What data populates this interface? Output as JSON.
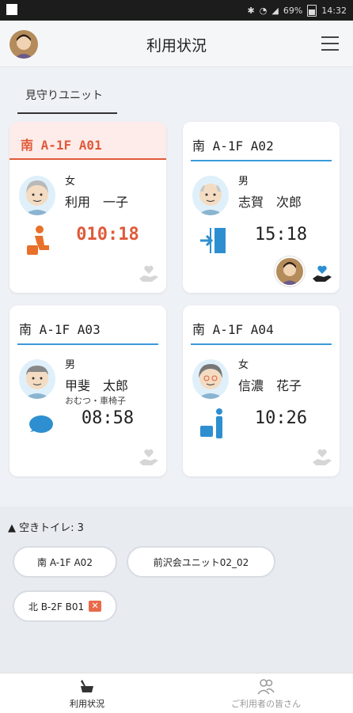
{
  "status_bar": {
    "battery": "69%",
    "time": "14:32"
  },
  "app": {
    "title": "利用状況"
  },
  "tab": {
    "label": "見守りユニット"
  },
  "units": [
    {
      "name": "南 A-1F A01",
      "gender": "女",
      "user_name": "利用　一子",
      "note": "",
      "time": "010:18",
      "state": "toilet-seated",
      "alert": true
    },
    {
      "name": "南 A-1F A02",
      "gender": "男",
      "user_name": "志賀　次郎",
      "note": "",
      "time": "15:18",
      "state": "exit",
      "alert": false
    },
    {
      "name": "南 A-1F A03",
      "gender": "男",
      "user_name": "甲斐　太郎",
      "note": "おむつ・車椅子",
      "time": "08:58",
      "state": "speech",
      "alert": false
    },
    {
      "name": "南 A-1F A04",
      "gender": "女",
      "user_name": "信濃　花子",
      "note": "",
      "time": "10:26",
      "state": "toilet-standing",
      "alert": false
    }
  ],
  "vacant": {
    "title": "▲ 空きトイレ: 3",
    "chips": [
      {
        "label": "南 A-1F A02"
      },
      {
        "label": "前沢会ユニット02_02"
      },
      {
        "label": "北 B-2F B01"
      }
    ]
  },
  "nav": {
    "usage": "利用状況",
    "users": "ご利用者の皆さん"
  },
  "colors": {
    "accent": "#3a9ad9",
    "alert": "#e05a3a"
  }
}
